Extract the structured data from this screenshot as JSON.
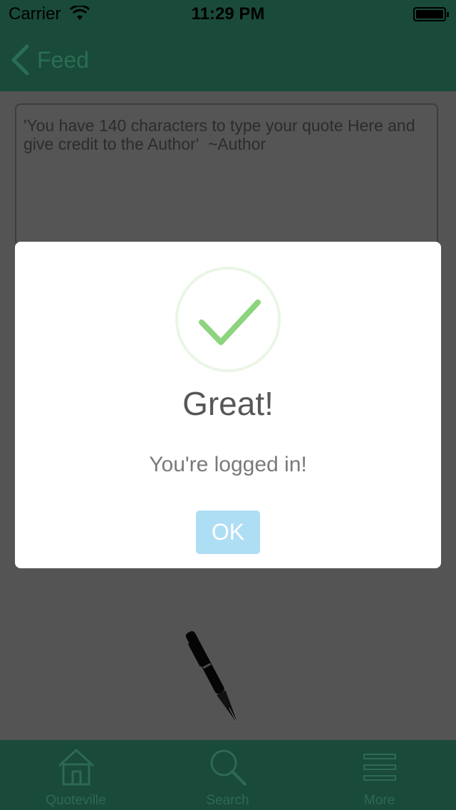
{
  "status_bar": {
    "carrier": "Carrier",
    "time": "11:29 PM",
    "wifi_icon": "wifi-icon",
    "battery_icon": "battery-icon"
  },
  "nav": {
    "back_label": "Feed",
    "back_icon": "chevron-left-icon"
  },
  "compose": {
    "placeholder": "'You have 140 characters to type your quote Here and give credit to the Author'  ~Author",
    "pen_icon": "fountain-pen-icon"
  },
  "tabs": [
    {
      "label": "Quoteville",
      "icon": "home-icon"
    },
    {
      "label": "Search",
      "icon": "search-icon"
    },
    {
      "label": "More",
      "icon": "menu-icon"
    }
  ],
  "alert": {
    "icon": "checkmark-icon",
    "title": "Great!",
    "message": "You're logged in!",
    "ok_label": "OK"
  },
  "colors": {
    "nav_green": "#1a4a3a",
    "check_green": "#8cd47e",
    "ok_button": "#aedef4",
    "dim_background": "#545454"
  }
}
